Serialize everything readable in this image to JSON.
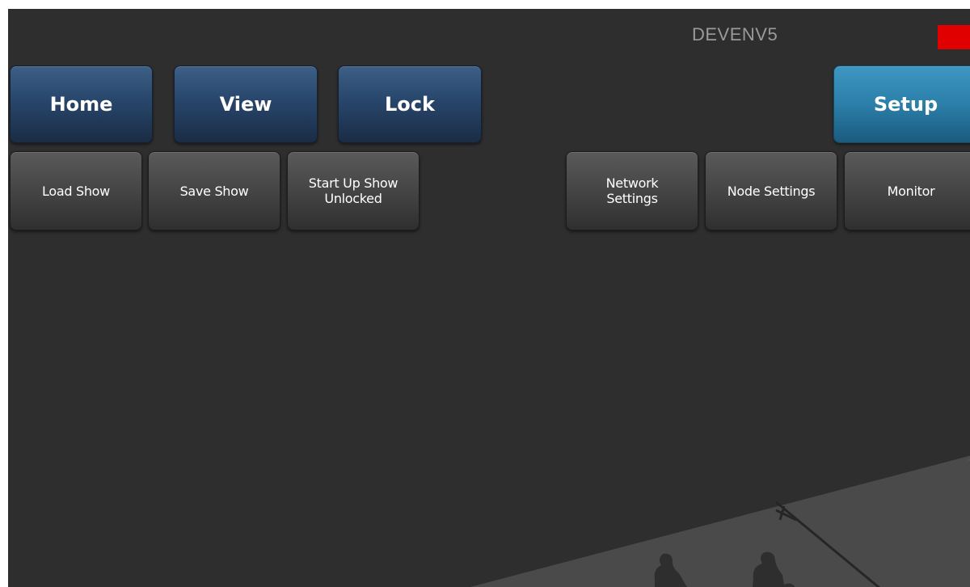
{
  "header": {
    "device_name": "DEVENV5",
    "status_color": "#e00000"
  },
  "main_tabs": [
    {
      "label": "Home",
      "active": false
    },
    {
      "label": "View",
      "active": false
    },
    {
      "label": "Lock",
      "active": false
    },
    {
      "label": "Setup",
      "active": true
    }
  ],
  "sub_buttons": [
    {
      "label": "Load Show"
    },
    {
      "label": "Save Show"
    },
    {
      "label": "Start Up Show\nUnlocked"
    },
    {
      "label": "Network\nSettings"
    },
    {
      "label": "Node Settings"
    },
    {
      "label": "Monitor"
    }
  ],
  "colors": {
    "background": "#2e2e2e",
    "tab_blue": "#28466b",
    "tab_active": "#2b7fa9",
    "button_gray": "#474747"
  }
}
